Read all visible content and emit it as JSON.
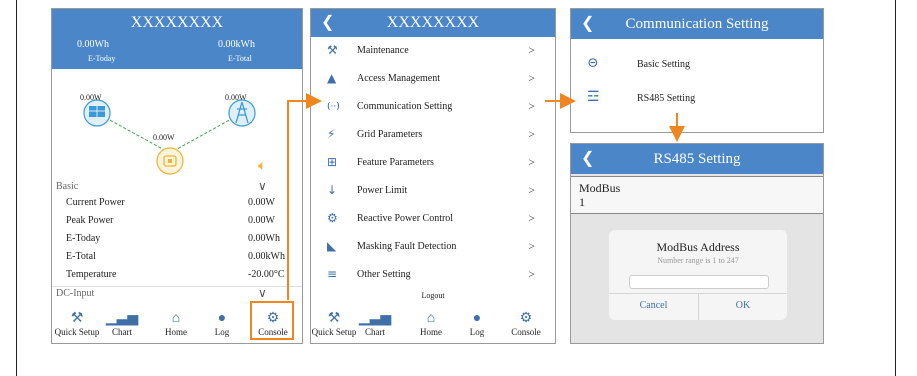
{
  "home": {
    "title": "XXXXXXXX",
    "today_value": "0.00Wh",
    "today_label": "E-Today",
    "total_value": "0.00kWh",
    "total_label": "E-Total",
    "pv_power": "0.00W",
    "grid_power": "0.00W",
    "inverter_power": "0.00W",
    "basic_label": "Basic",
    "basic_rows": [
      {
        "label": "Current Power",
        "value": "0.00W"
      },
      {
        "label": "Peak Power",
        "value": "0.00W"
      },
      {
        "label": "E-Today",
        "value": "0.00Wh"
      },
      {
        "label": "E-Total",
        "value": "0.00kWh"
      },
      {
        "label": "Temperature",
        "value": "-20.00°C"
      }
    ],
    "dc_label": "DC-Input"
  },
  "console": {
    "title": "XXXXXXXX",
    "items": [
      {
        "label": "Maintenance",
        "icon": "wrench-icon"
      },
      {
        "label": "Access Management",
        "icon": "user-icon"
      },
      {
        "label": "Communication Setting",
        "icon": "signal-icon"
      },
      {
        "label": "Grid Parameters",
        "icon": "lightning-icon"
      },
      {
        "label": "Feature Parameters",
        "icon": "grid-icon"
      },
      {
        "label": "Power Limit",
        "icon": "arrow-down-icon"
      },
      {
        "label": "Reactive Power Control",
        "icon": "gear-icon"
      },
      {
        "label": "Masking Fault Detection",
        "icon": "mask-icon"
      },
      {
        "label": "Other Setting",
        "icon": "menu-icon"
      }
    ],
    "logout": "Logout"
  },
  "nav": {
    "quick_setup": "Quick Setup",
    "chart": "Chart",
    "home": "Home",
    "log": "Log",
    "console": "Console"
  },
  "comm": {
    "title": "Communication Setting",
    "basic": "Basic Setting",
    "rs485": "RS485 Setting"
  },
  "rs485": {
    "title": "RS485 Setting",
    "modbus_label": "ModBus",
    "modbus_value": "1",
    "dialog_title": "ModBus Address",
    "dialog_hint": "Number range is 1 to 247",
    "cancel": "Cancel",
    "ok": "OK"
  },
  "colors": {
    "header": "#4a86c8",
    "accent": "#f0861f",
    "icon": "#3f6fa8"
  }
}
